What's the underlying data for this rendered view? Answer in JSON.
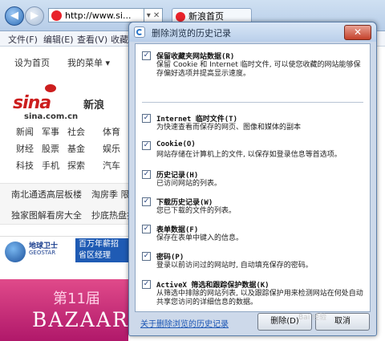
{
  "browser": {
    "url": "http://www.si...",
    "url_tail": "▾ ✕",
    "tab_title": "新浪首页",
    "menus": [
      "文件(F)",
      "编辑(E)",
      "查看(V)",
      "收藏"
    ],
    "page": {
      "set_home": "设为首页",
      "my_menu": "我的菜单 ▾",
      "logo_word": "sina",
      "logo_cn": "新浪",
      "logo_com": "sina.com.cn",
      "nav": [
        [
          "新闻",
          "军事",
          "社会",
          "体育"
        ],
        [
          "财经",
          "股票",
          "基金",
          "娱乐"
        ],
        [
          "科技",
          "手机",
          "探索",
          "汽车"
        ]
      ],
      "news": [
        [
          "南北通透高层板楼",
          "淘房季 限"
        ],
        [
          "独家图解看房大全",
          "抄底热盘打"
        ]
      ],
      "ad1": {
        "brand": "地球卫士",
        "brand_en": "GEOSTAR",
        "blue_line1": "百万年薪招",
        "blue_line2": "省区经理"
      },
      "ad2": {
        "issue": "第11届",
        "title": "BAZAAR"
      }
    }
  },
  "dialog": {
    "title": "删除浏览的历史记录",
    "close": "✕",
    "options": [
      {
        "checked": true,
        "title": "保留收藏夹网站数据(R)",
        "desc": "保留 Cookie 和 Internet 临时文件, 可以使您收藏的网站能够保存偏好选项并提高显示速度。"
      },
      {
        "checked": true,
        "title": "Internet 临时文件(T)",
        "desc": "为快速查看而保存的网页、图像和媒体的副本"
      },
      {
        "checked": true,
        "title": "Cookie(O)",
        "desc": "网站存储在计算机上的文件, 以保存如登录信息等首选项。"
      },
      {
        "checked": true,
        "title": "历史记录(H)",
        "desc": "已访问网站的列表。"
      },
      {
        "checked": true,
        "title": "下载历史记录(W)",
        "desc": "您已下载的文件的列表。"
      },
      {
        "checked": true,
        "title": "表单数据(F)",
        "desc": "保存在表单中键入的信息。"
      },
      {
        "checked": true,
        "title": "密码(P)",
        "desc": "登录以前访问过的网站时, 自动填充保存的密码。"
      },
      {
        "checked": true,
        "title": "ActiveX 筛选和跟踪保护数据(K)",
        "desc": "从筛选中排除的网站列表, 以及跟踪保护用来检测网站在何处自动共享您访问的详细信息的数据。"
      }
    ],
    "link": "关于删除浏览的历史记录",
    "delete_button": "删除(D)",
    "cancel_button": "取消",
    "watermark": "Bai 经验"
  }
}
